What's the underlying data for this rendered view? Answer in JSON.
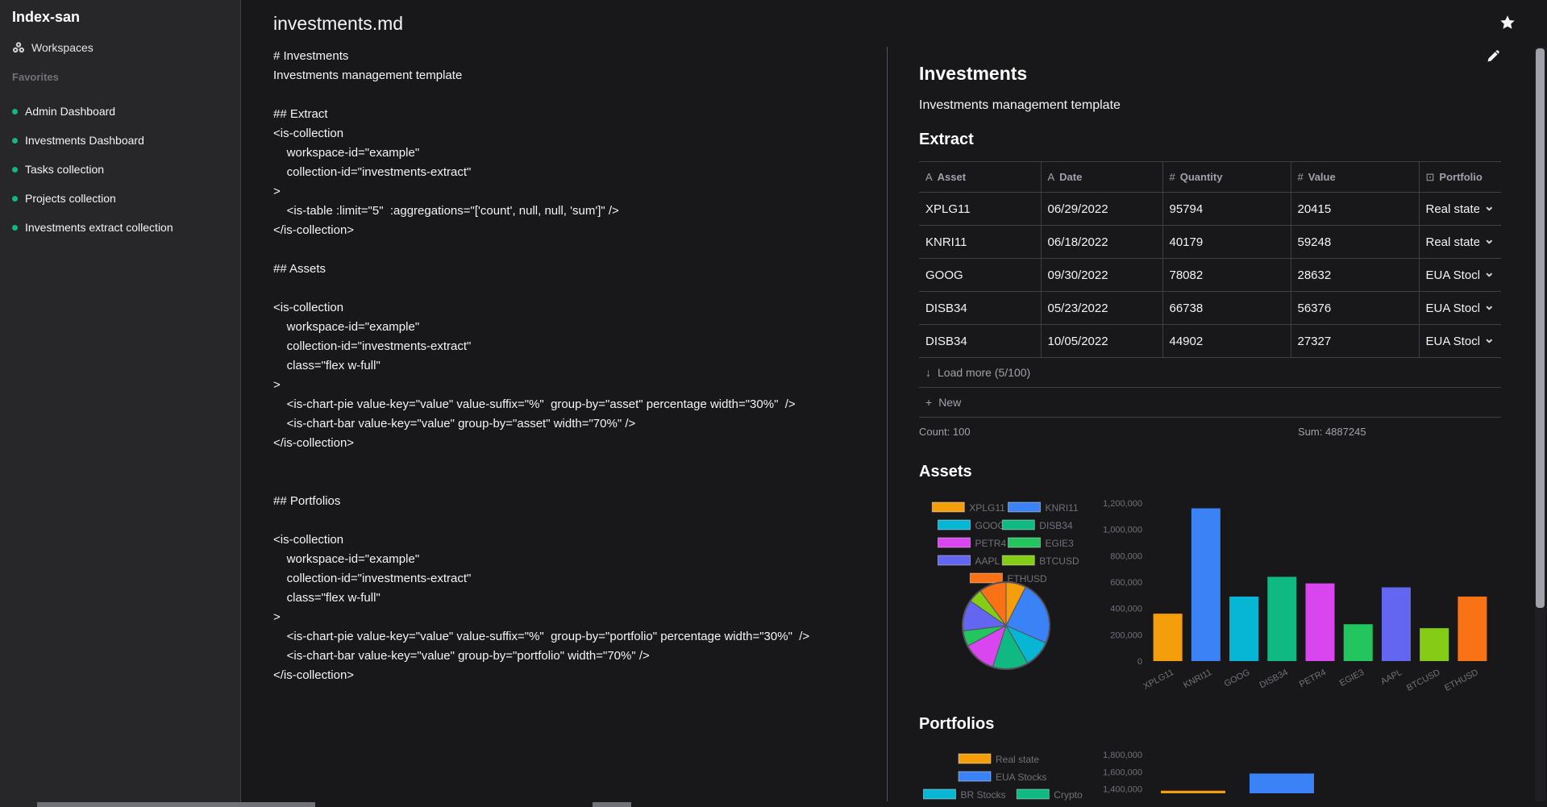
{
  "app": {
    "title": "Index-san"
  },
  "sidebar": {
    "workspaces_label": "Workspaces",
    "favorites_label": "Favorites",
    "items": [
      {
        "label": "Admin Dashboard"
      },
      {
        "label": "Investments Dashboard"
      },
      {
        "label": "Tasks collection"
      },
      {
        "label": "Projects collection"
      },
      {
        "label": "Investments extract collection"
      }
    ]
  },
  "file": {
    "name": "investments.md"
  },
  "source_lines": [
    "# Investments",
    "Investments management template",
    "",
    "## Extract",
    "<is-collection",
    "    workspace-id=\"example\"",
    "    collection-id=\"investments-extract\"",
    ">",
    "    <is-table :limit=\"5\"  :aggregations=\"['count', null, null, 'sum']\" />",
    "</is-collection>",
    "",
    "## Assets",
    "",
    "<is-collection",
    "    workspace-id=\"example\"",
    "    collection-id=\"investments-extract\"",
    "    class=\"flex w-full\"",
    ">",
    "    <is-chart-pie value-key=\"value\" value-suffix=\"%\"  group-by=\"asset\" percentage width=\"30%\"  />",
    "    <is-chart-bar value-key=\"value\" group-by=\"asset\" width=\"70%\" />",
    "</is-collection>",
    "",
    "",
    "## Portfolios",
    "",
    "<is-collection",
    "    workspace-id=\"example\"",
    "    collection-id=\"investments-extract\"",
    "    class=\"flex w-full\"",
    ">",
    "    <is-chart-pie value-key=\"value\" value-suffix=\"%\"  group-by=\"portfolio\" percentage width=\"30%\"  />",
    "    <is-chart-bar value-key=\"value\" group-by=\"portfolio\" width=\"70%\" />",
    "</is-collection>"
  ],
  "preview": {
    "title": "Investments",
    "description": "Investments management template",
    "extract_heading": "Extract",
    "assets_heading": "Assets",
    "portfolios_heading": "Portfolios",
    "table": {
      "columns": [
        {
          "icon": "text-icon",
          "glyph": "A",
          "label": "Asset"
        },
        {
          "icon": "text-icon",
          "glyph": "A",
          "label": "Date"
        },
        {
          "icon": "number-icon",
          "glyph": "#",
          "label": "Quantity"
        },
        {
          "icon": "number-icon",
          "glyph": "#",
          "label": "Value"
        },
        {
          "icon": "select-icon",
          "glyph": "⊡",
          "label": "Portfolio"
        }
      ],
      "rows": [
        [
          "XPLG11",
          "06/29/2022",
          "95794",
          "20415",
          "Real state"
        ],
        [
          "KNRI11",
          "06/18/2022",
          "40179",
          "59248",
          "Real state"
        ],
        [
          "GOOG",
          "09/30/2022",
          "78082",
          "28632",
          "EUA Stocks"
        ],
        [
          "DISB34",
          "05/23/2022",
          "66738",
          "56376",
          "EUA Stocks"
        ],
        [
          "DISB34",
          "10/05/2022",
          "44902",
          "27327",
          "EUA Stocks"
        ]
      ],
      "load_more": "Load more (5/100)",
      "new_label": "New",
      "count_text": "Count: 100",
      "sum_text": "Sum: 4887245"
    }
  },
  "colors": {
    "accent_green": "#10b981",
    "palette": [
      "#f59e0b",
      "#3b82f6",
      "#06b6d4",
      "#10b981",
      "#d946ef",
      "#22c55e",
      "#6366f1",
      "#84cc16",
      "#f97316"
    ]
  },
  "chart_data": [
    {
      "type": "pie",
      "categories": [
        "XPLG11",
        "KNRI11",
        "GOOG",
        "DISB34",
        "PETR4",
        "EGIE3",
        "AAPL",
        "BTCUSD",
        "ETHUSD"
      ],
      "values": [
        360000,
        1160000,
        490000,
        640000,
        590000,
        280000,
        560000,
        250000,
        490000
      ],
      "title": "",
      "legend": "top"
    },
    {
      "type": "bar",
      "categories": [
        "XPLG11",
        "KNRI11",
        "GOOG",
        "DISB34",
        "PETR4",
        "EGIE3",
        "AAPL",
        "BTCUSD",
        "ETHUSD"
      ],
      "values": [
        360000,
        1160000,
        490000,
        640000,
        590000,
        280000,
        560000,
        250000,
        490000
      ],
      "yticks": [
        "0",
        "200,000",
        "400,000",
        "600,000",
        "800,000",
        "1,000,000",
        "1,200,000"
      ],
      "ylim": [
        0,
        1200000
      ],
      "xlabel": "",
      "ylabel": "",
      "grid": false
    },
    {
      "type": "pie",
      "categories": [
        "Real state",
        "EUA Stocks",
        "BR Stocks",
        "Crypto"
      ],
      "title": "",
      "legend": "top"
    },
    {
      "type": "bar",
      "categories": [
        "Real state",
        "EUA Stocks"
      ],
      "values": [
        1380000,
        1580000
      ],
      "yticks": [
        "1,400,000",
        "1,600,000",
        "1,800,000"
      ],
      "ylim": [
        1350000,
        1800000
      ],
      "grid": false
    }
  ]
}
